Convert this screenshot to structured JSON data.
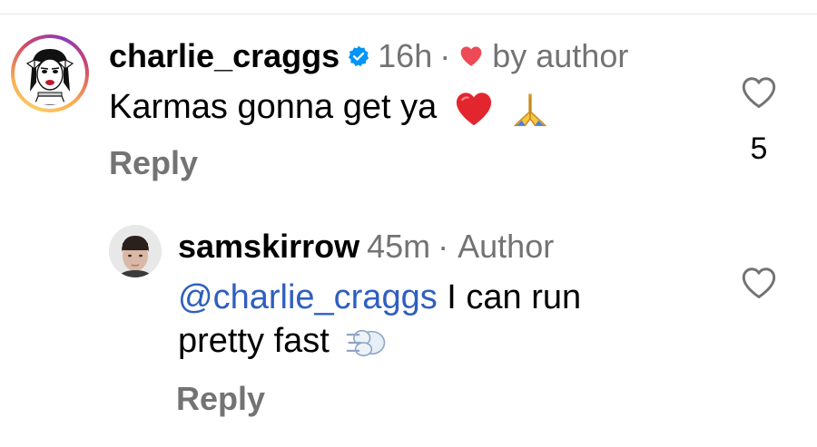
{
  "comment": {
    "username": "charlie_craggs",
    "time": "16h",
    "separator": "·",
    "by_author": "by author",
    "text": "Karmas gonna get ya",
    "reply_label": "Reply",
    "like_count": "5",
    "emojis": [
      "red-heart",
      "folded-hands"
    ]
  },
  "reply": {
    "username": "samskirrow",
    "time": "45m",
    "separator": "·",
    "author_tag": "Author",
    "mention": "@charlie_craggs",
    "text_after_mention": "I can run",
    "text_line2": "pretty fast",
    "reply_label": "Reply",
    "emojis": [
      "dash-symbol"
    ]
  },
  "colors": {
    "text": "#000000",
    "secondary": "#737373",
    "mention": "#2f5fbf",
    "verified": "#0095f6",
    "heart_red": "#ed4956"
  },
  "icons": {
    "verified": "verified-badge-icon",
    "author_like": "red-heart-icon",
    "like": "heart-outline-icon"
  }
}
